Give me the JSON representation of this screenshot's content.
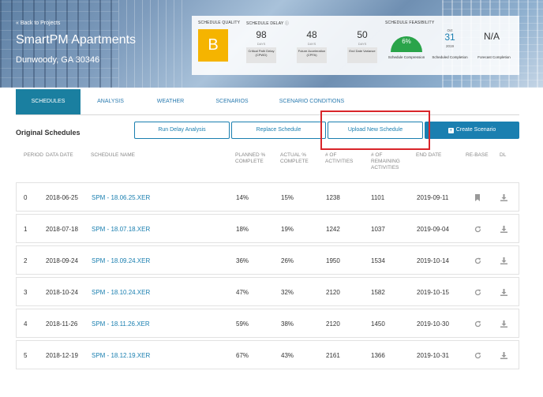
{
  "header": {
    "back_link": "« Back to Projects",
    "project_name": "SmartPM Apartments",
    "project_location": "Dunwoody, GA 30346"
  },
  "metrics": {
    "quality_label": "SCHEDULE QUALITY",
    "quality_grade": "B",
    "delay_label": "SCHEDULE DELAY ⓘ",
    "delay_items": [
      {
        "value": "98",
        "unit": "DAYS",
        "caption": "Critical Path Delay (CPWD)"
      },
      {
        "value": "48",
        "unit": "DAYS",
        "caption": "Future Acceleration (CPFA)"
      },
      {
        "value": "50",
        "unit": "DAYS",
        "caption": "End Date Variance"
      }
    ],
    "feasibility_label": "SCHEDULE FEASIBILITY",
    "compression_value": "6%",
    "compression_fraction": 0.06,
    "compression_caption": "Schedule Compression",
    "completion_month": "Oct",
    "completion_day": "31",
    "completion_year": "2019",
    "completion_caption": "Scheduled Completion",
    "forecast_value": "N/A",
    "forecast_caption": "Forecast Completion",
    "gauge_color": "#2aa44a"
  },
  "tabs": [
    {
      "label": "SCHEDULES",
      "active": true
    },
    {
      "label": "ANALYSIS",
      "active": false
    },
    {
      "label": "WEATHER",
      "active": false
    },
    {
      "label": "SCENARIOS",
      "active": false
    },
    {
      "label": "SCENARIO CONDITIONS",
      "active": false
    }
  ],
  "toolbar": {
    "title": "Original Schedules",
    "run_delay_label": "Run Delay Analysis",
    "replace_label": "Replace Schedule",
    "upload_label": "Upload New Schedule",
    "create_label": "Create Scenario",
    "accent_color": "#1a7fb0",
    "highlight_color": "#d9252a"
  },
  "table": {
    "headers": {
      "period": "PERIOD",
      "data_date": "DATA DATE",
      "schedule_name": "SCHEDULE NAME",
      "planned": "PLANNED % COMPLETE",
      "actual": "ACTUAL % COMPLETE",
      "activities": "# OF ACTIVITIES",
      "remaining": "# OF REMAINING ACTIVITIES",
      "end_date": "END DATE",
      "rebase": "RE-BASE",
      "dl": "DL"
    },
    "rows": [
      {
        "period": "0",
        "date": "2018-06-25",
        "name": "SPM - 18.06.25.XER",
        "planned": "14%",
        "actual": "15%",
        "activities": "1238",
        "remaining": "1101",
        "end": "2019-09-11",
        "rebase_icon": "bookmark-icon"
      },
      {
        "period": "1",
        "date": "2018-07-18",
        "name": "SPM - 18.07.18.XER",
        "planned": "18%",
        "actual": "19%",
        "activities": "1242",
        "remaining": "1037",
        "end": "2019-09-04",
        "rebase_icon": "refresh-icon"
      },
      {
        "period": "2",
        "date": "2018-09-24",
        "name": "SPM - 18.09.24.XER",
        "planned": "36%",
        "actual": "26%",
        "activities": "1950",
        "remaining": "1534",
        "end": "2019-10-14",
        "rebase_icon": "refresh-icon"
      },
      {
        "period": "3",
        "date": "2018-10-24",
        "name": "SPM - 18.10.24.XER",
        "planned": "47%",
        "actual": "32%",
        "activities": "2120",
        "remaining": "1582",
        "end": "2019-10-15",
        "rebase_icon": "refresh-icon"
      },
      {
        "period": "4",
        "date": "2018-11-26",
        "name": "SPM - 18.11.26.XER",
        "planned": "59%",
        "actual": "38%",
        "activities": "2120",
        "remaining": "1450",
        "end": "2019-10-30",
        "rebase_icon": "refresh-icon"
      },
      {
        "period": "5",
        "date": "2018-12-19",
        "name": "SPM - 18.12.19.XER",
        "planned": "67%",
        "actual": "43%",
        "activities": "2161",
        "remaining": "1366",
        "end": "2019-10-31",
        "rebase_icon": "refresh-icon"
      }
    ]
  }
}
